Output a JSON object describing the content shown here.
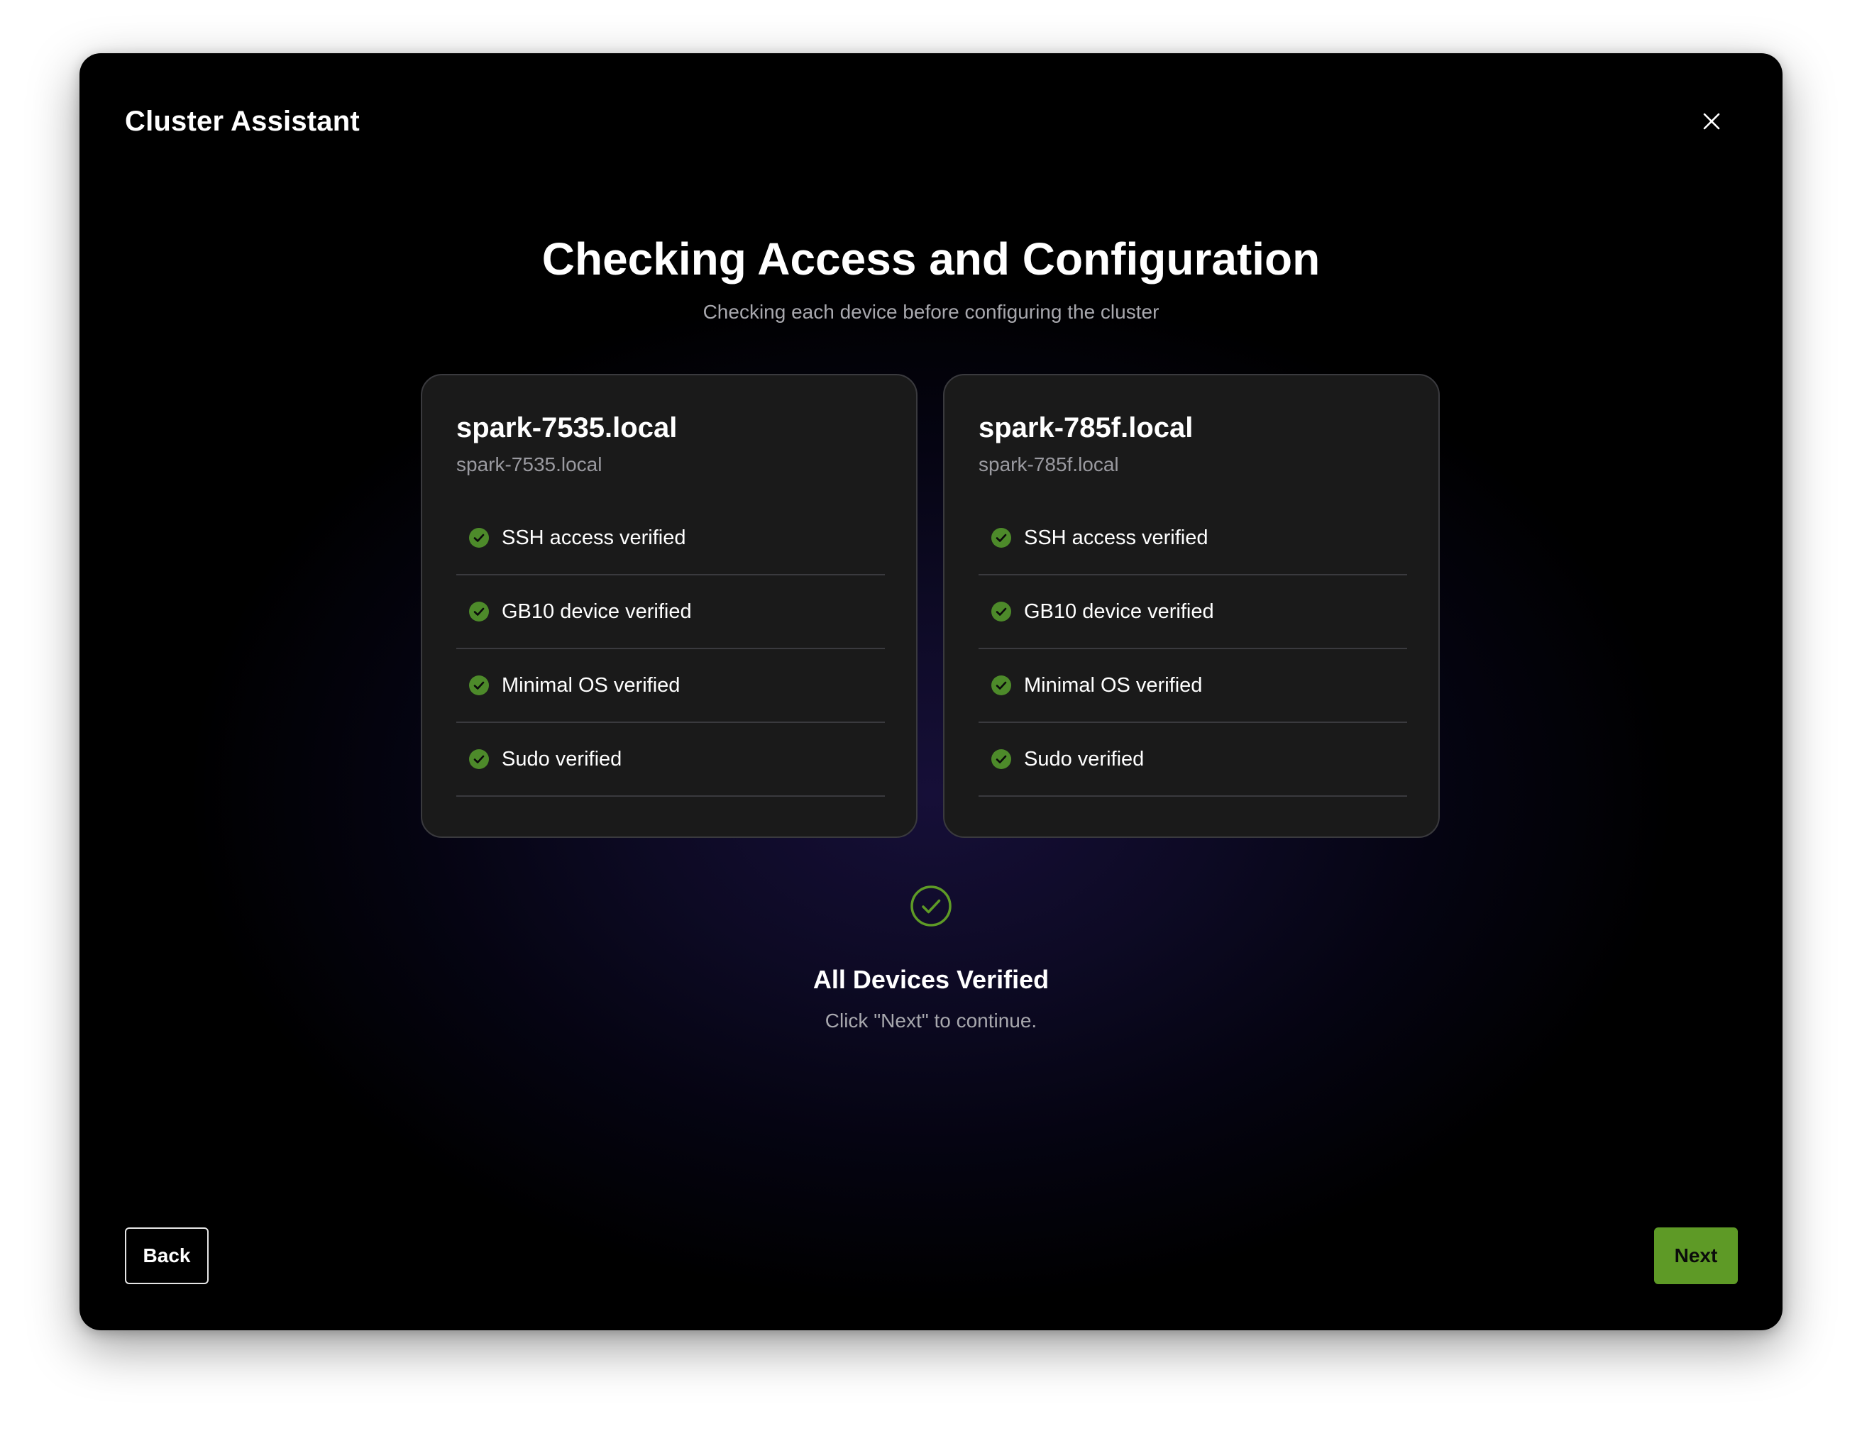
{
  "window": {
    "title": "Cluster Assistant",
    "close_icon": "close-icon"
  },
  "header": {
    "title": "Checking Access and Configuration",
    "subtitle": "Checking each device before configuring the cluster"
  },
  "devices": [
    {
      "name": "spark-7535.local",
      "hostname": "spark-7535.local",
      "checks": [
        {
          "label": "SSH access verified",
          "status": "verified",
          "icon": "check-circle-icon"
        },
        {
          "label": "GB10 device verified",
          "status": "verified",
          "icon": "check-circle-icon"
        },
        {
          "label": "Minimal OS verified",
          "status": "verified",
          "icon": "check-circle-icon"
        },
        {
          "label": "Sudo verified",
          "status": "verified",
          "icon": "check-circle-icon"
        }
      ]
    },
    {
      "name": "spark-785f.local",
      "hostname": "spark-785f.local",
      "checks": [
        {
          "label": "SSH access verified",
          "status": "verified",
          "icon": "check-circle-icon"
        },
        {
          "label": "GB10 device verified",
          "status": "verified",
          "icon": "check-circle-icon"
        },
        {
          "label": "Minimal OS verified",
          "status": "verified",
          "icon": "check-circle-icon"
        },
        {
          "label": "Sudo verified",
          "status": "verified",
          "icon": "check-circle-icon"
        }
      ]
    }
  ],
  "status": {
    "icon": "check-circle-outline-icon",
    "title": "All Devices Verified",
    "message": "Click \"Next\" to continue."
  },
  "footer": {
    "back_label": "Back",
    "next_label": "Next"
  },
  "colors": {
    "accent_green": "#5e9a26",
    "check_green": "#4d8a2a",
    "card_bg": "#1a1a1a",
    "card_border": "#3a3a3e",
    "muted_text": "#a8a8ae"
  }
}
